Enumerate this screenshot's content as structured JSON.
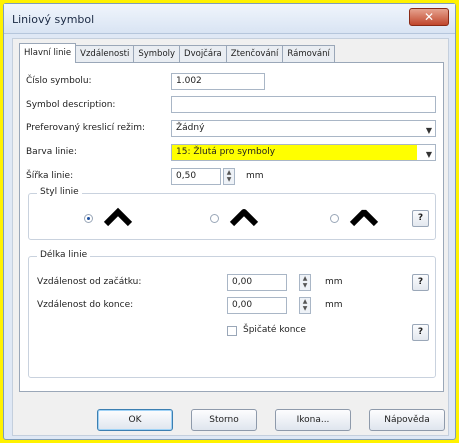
{
  "window": {
    "title": "Liniový symbol",
    "close_label": "✕"
  },
  "tabs": [
    "Hlavní linie",
    "Vzdálenosti",
    "Symboly",
    "Dvojčára",
    "Ztenčování",
    "Rámování"
  ],
  "form": {
    "symbol_number_label": "Číslo symbolu:",
    "symbol_number_value": "1.002",
    "description_label": "Symbol description:",
    "description_value": "",
    "draw_mode_label": "Preferovaný kreslicí režim:",
    "draw_mode_value": "Žádný",
    "line_color_label": "Barva linie:",
    "line_color_value": "15: Žlutá pro symboly",
    "line_width_label": "Šířka linie:",
    "line_width_value": "0,50",
    "line_width_unit": "mm"
  },
  "line_style": {
    "title": "Styl linie",
    "options": [
      "miter",
      "round",
      "bevel"
    ],
    "selected_index": 0,
    "help_label": "?"
  },
  "line_length": {
    "title": "Délka linie",
    "start_distance_label": "Vzdálenost od začátku:",
    "start_distance_value": "0,00",
    "start_unit": "mm",
    "end_distance_label": "Vzdálenost do konce:",
    "end_distance_value": "0,00",
    "end_unit": "mm",
    "pointed_ends_label": "Špičaté konce",
    "pointed_ends_checked": false,
    "help_label": "?"
  },
  "buttons": {
    "ok": "OK",
    "cancel": "Storno",
    "icon": "Ikona...",
    "help": "Nápověda"
  },
  "colors": {
    "line_color_swatch": "#ffff00",
    "accent": "#3c7fb1"
  }
}
